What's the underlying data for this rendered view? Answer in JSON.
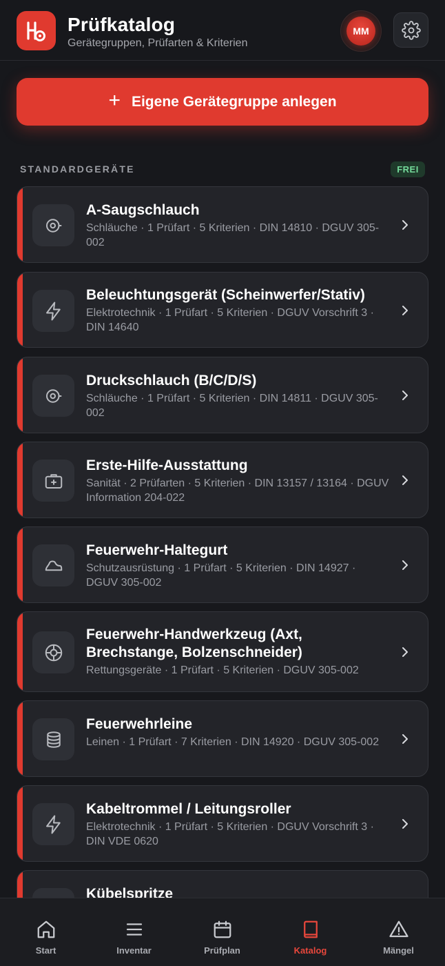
{
  "header": {
    "title": "Prüfkatalog",
    "subtitle": "Gerätegruppen, Prüfarten & Kriterien",
    "avatar_initials": "MM",
    "logo_icon": "app-logo-icon",
    "settings_icon": "gear-icon"
  },
  "cta": {
    "label": "Eigene Gerätegruppe anlegen",
    "icon": "plus-icon"
  },
  "section": {
    "title": "STANDARDGERÄTE",
    "badge": "FREI"
  },
  "items": [
    {
      "title": "A-Saugschlauch",
      "meta": "Schläuche · 1 Prüfart · 5 Kriterien · DIN 14810 · DGUV 305-002",
      "icon": "hose-icon"
    },
    {
      "title": "Beleuchtungsgerät (Scheinwerfer/Stativ)",
      "meta": "Elektrotechnik · 1 Prüfart · 5 Kriterien · DGUV Vorschrift 3 · DIN 14640",
      "icon": "lightning-icon"
    },
    {
      "title": "Druckschlauch (B/C/D/S)",
      "meta": "Schläuche · 1 Prüfart · 5 Kriterien · DIN 14811 · DGUV 305-002",
      "icon": "hose-icon"
    },
    {
      "title": "Erste-Hilfe-Ausstattung",
      "meta": "Sanität · 2 Prüfarten · 5 Kriterien · DIN 13157 / 13164 · DGUV Information 204-022",
      "icon": "first-aid-kit-icon"
    },
    {
      "title": "Feuerwehr-Haltegurt",
      "meta": "Schutzausrüstung · 1 Prüfart · 5 Kriterien · DIN 14927 · DGUV 305-002",
      "icon": "harness-icon"
    },
    {
      "title": "Feuerwehr-Handwerkzeug (Axt, Brechstange, Bolzenschneider)",
      "meta": "Rettungsgeräte · 1 Prüfart · 5 Kriterien · DGUV 305-002",
      "icon": "lifebuoy-icon"
    },
    {
      "title": "Feuerwehrleine",
      "meta": "Leinen · 1 Prüfart · 7 Kriterien · DIN 14920 · DGUV 305-002",
      "icon": "rope-icon"
    },
    {
      "title": "Kabeltrommel / Leitungsroller",
      "meta": "Elektrotechnik · 1 Prüfart · 5 Kriterien · DGUV Vorschrift 3 · DIN VDE 0620",
      "icon": "lightning-icon"
    },
    {
      "title": "Kübelspritze",
      "meta": "",
      "icon": "bucket-pump-icon"
    }
  ],
  "nav": [
    {
      "label": "Start",
      "icon": "home-icon",
      "active": false
    },
    {
      "label": "Inventar",
      "icon": "list-icon",
      "active": false
    },
    {
      "label": "Prüfplan",
      "icon": "calendar-icon",
      "active": false
    },
    {
      "label": "Katalog",
      "icon": "book-icon",
      "active": true
    },
    {
      "label": "Mängel",
      "icon": "warning-icon",
      "active": false
    }
  ],
  "colors": {
    "accent": "#e03a2f",
    "background": "#17181c",
    "card": "#232429",
    "badge_text": "#74d99a"
  }
}
